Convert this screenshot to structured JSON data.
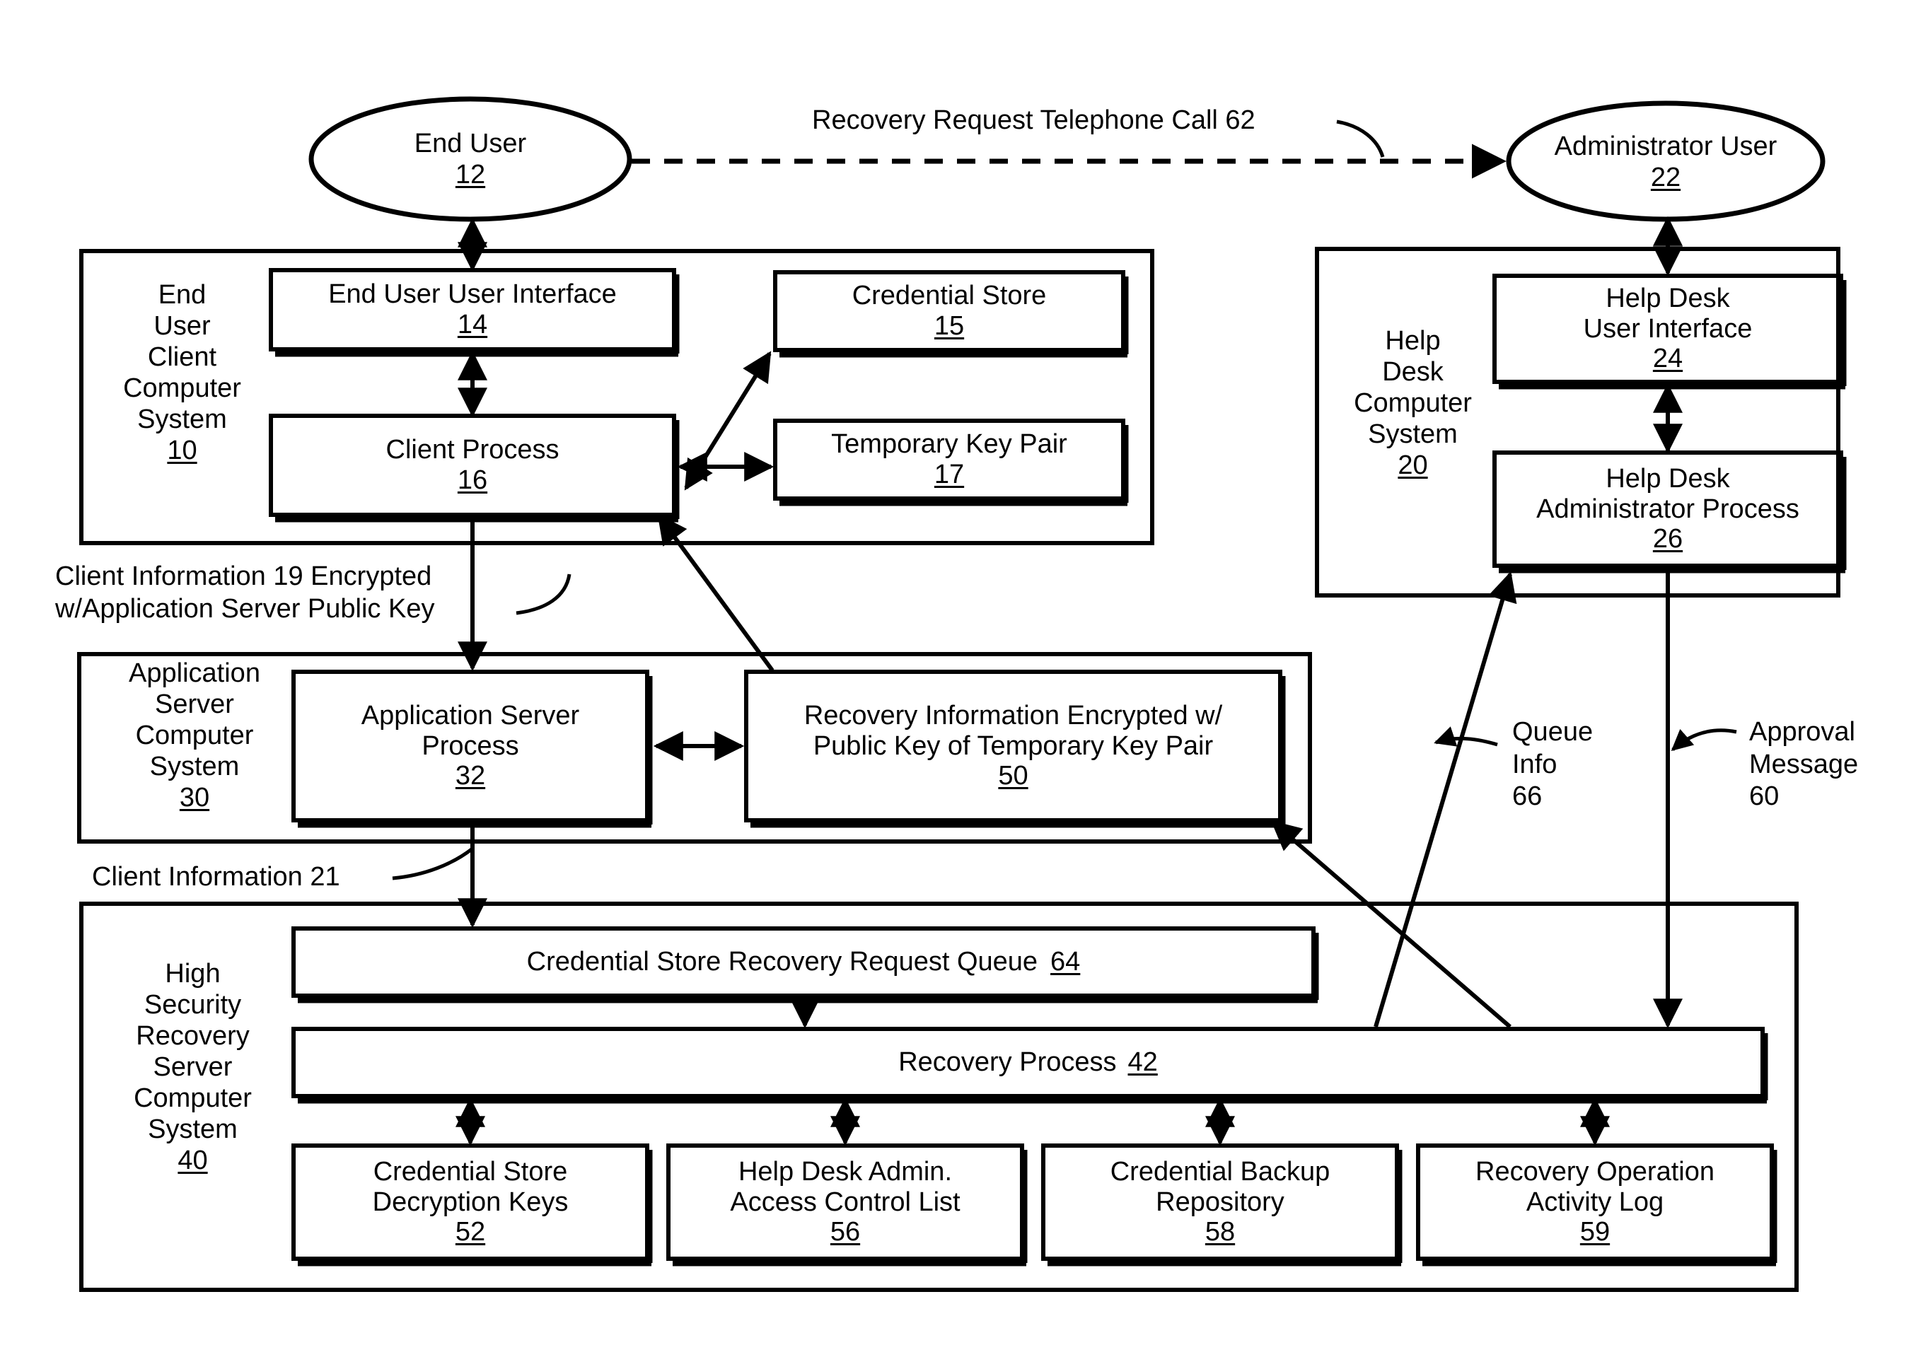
{
  "figure": {
    "type": "patent-block-diagram",
    "title": "Credential Store Recovery Architecture"
  },
  "actors": [
    {
      "id": "end-user",
      "label": "End User",
      "ref": "12"
    },
    {
      "id": "administrator-user",
      "label": "Administrator User",
      "ref": "22"
    }
  ],
  "systems": [
    {
      "id": "end-user-client-computer-system",
      "label": "End\nUser\nClient\nComputer\nSystem",
      "ref": "10"
    },
    {
      "id": "help-desk-computer-system",
      "label": "Help\nDesk\nComputer\nSystem",
      "ref": "20"
    },
    {
      "id": "application-server-computer-system",
      "label": "Application\nServer\nComputer\nSystem",
      "ref": "30"
    },
    {
      "id": "high-security-recovery-server-computer-system",
      "label": "High\nSecurity\nRecovery\nServer\nComputer\nSystem",
      "ref": "40"
    }
  ],
  "blocks": [
    {
      "id": "end-user-user-interface",
      "label": "End User User Interface",
      "ref": "14"
    },
    {
      "id": "client-process",
      "label": "Client Process",
      "ref": "16"
    },
    {
      "id": "credential-store",
      "label": "Credential Store",
      "ref": "15"
    },
    {
      "id": "temporary-key-pair",
      "label": "Temporary Key Pair",
      "ref": "17"
    },
    {
      "id": "help-desk-user-interface",
      "label": "Help Desk\nUser Interface",
      "ref": "24"
    },
    {
      "id": "help-desk-administrator-process",
      "label": "Help Desk\nAdministrator Process",
      "ref": "26"
    },
    {
      "id": "application-server-process",
      "label": "Application Server\nProcess",
      "ref": "32"
    },
    {
      "id": "recovery-information-encrypted",
      "label": "Recovery Information Encrypted w/\nPublic Key of Temporary Key Pair",
      "ref": "50"
    },
    {
      "id": "credential-store-recovery-request-queue",
      "label": "Credential Store Recovery Request Queue",
      "ref": "64",
      "inline_ref": true
    },
    {
      "id": "recovery-process",
      "label": "Recovery Process",
      "ref": "42",
      "inline_ref": true
    },
    {
      "id": "credential-store-decryption-keys",
      "label": "Credential Store\nDecryption Keys",
      "ref": "52"
    },
    {
      "id": "help-desk-admin-access-control-list",
      "label": "Help Desk Admin.\nAccess Control List",
      "ref": "56"
    },
    {
      "id": "credential-backup-repository",
      "label": "Credential Backup\nRepository",
      "ref": "58"
    },
    {
      "id": "recovery-operation-activity-log",
      "label": "Recovery Operation\nActivity Log",
      "ref": "59"
    }
  ],
  "flow_labels": [
    {
      "id": "recovery-request-telephone-call",
      "text": "Recovery Request Telephone Call 62"
    },
    {
      "id": "client-information-19-encrypted",
      "text": "Client Information 19 Encrypted\nw/Application Server Public Key"
    },
    {
      "id": "client-information-21",
      "text": "Client Information 21"
    },
    {
      "id": "queue-info",
      "text": "Queue\nInfo\n66"
    },
    {
      "id": "approval-message",
      "text": "Approval\nMessage\n60"
    }
  ],
  "colors": {
    "stroke": "#000000",
    "background": "#ffffff",
    "text": "#000000"
  }
}
